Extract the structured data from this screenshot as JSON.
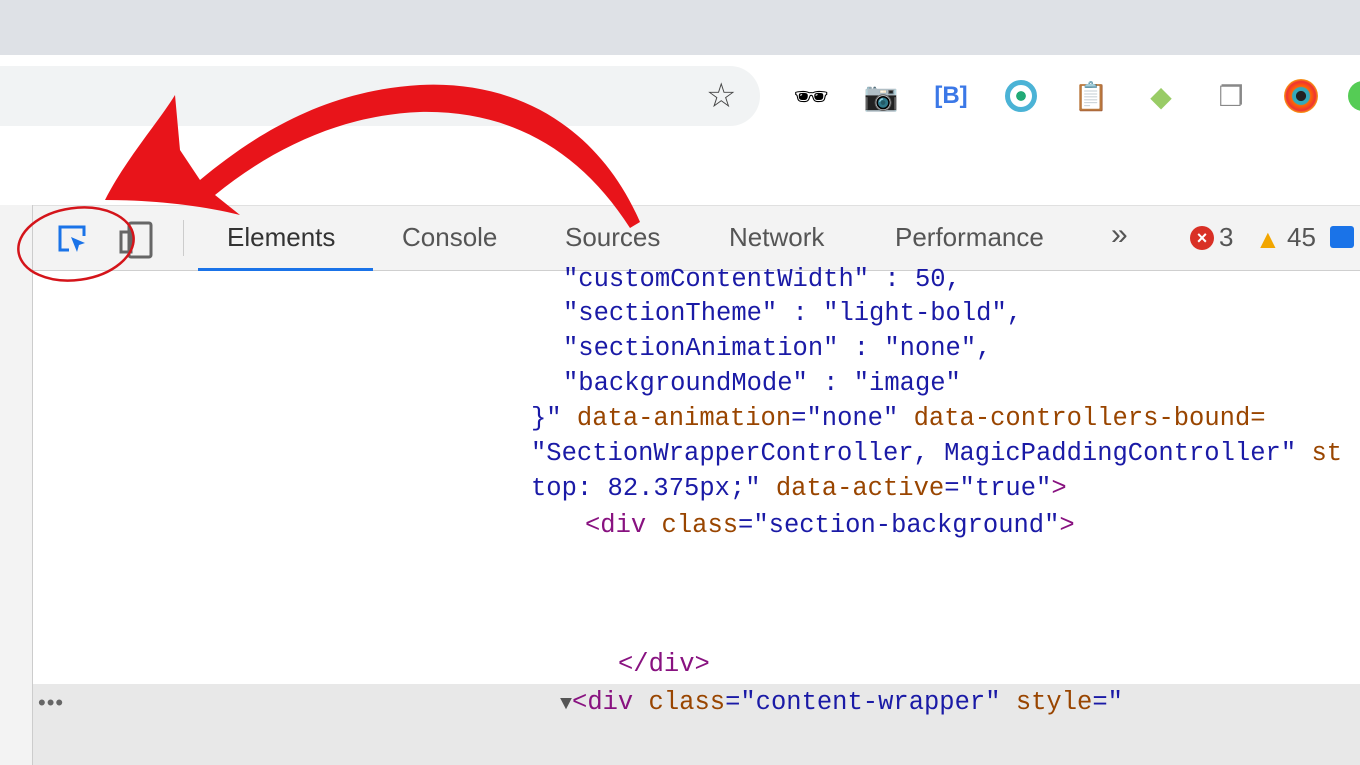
{
  "browser": {
    "extensions": [
      "incognito-icon",
      "camera-icon",
      "bracket-extension-icon",
      "target-extension-icon",
      "clipboard-icon",
      "pin-extension-icon",
      "copy-extension-icon",
      "color-eye-icon"
    ]
  },
  "devtools": {
    "tabs": [
      {
        "label": "Elements",
        "active": true
      },
      {
        "label": "Console"
      },
      {
        "label": "Sources"
      },
      {
        "label": "Network"
      },
      {
        "label": "Performance"
      }
    ],
    "more_tabs": "»",
    "errors": "3",
    "warnings": "45",
    "accent": "#1a73e8"
  },
  "code": {
    "l1": "\"customContentWidth\" : 50,",
    "l2": "\"sectionTheme\" : \"light-bold\",",
    "l3": "\"sectionAnimation\" : \"none\",",
    "l4": "\"backgroundMode\" : \"image\"",
    "l5a": "}\"",
    "l5b": "data-animation",
    "l5c": "=\"none\"",
    "l5d": "data-controllers-bound",
    "l5e": "=",
    "l6a": "\"SectionWrapperController, MagicPaddingController\"",
    "l6b": "st",
    "l7a": "top: 82.375px;\"",
    "l7b": "data-active",
    "l7c": "=\"true\"",
    "l7d": ">",
    "l8a": "<div",
    "l8b": "class",
    "l8c": "=\"section-background\"",
    "l8d": ">",
    "l9": "</div>",
    "l10a": "▼",
    "l10b": "<div",
    "l10c": "class",
    "l10d": "=\"content-wrapper\"",
    "l10e": "style",
    "l10f": "=\""
  },
  "annotation": {
    "color": "#e8141a"
  }
}
